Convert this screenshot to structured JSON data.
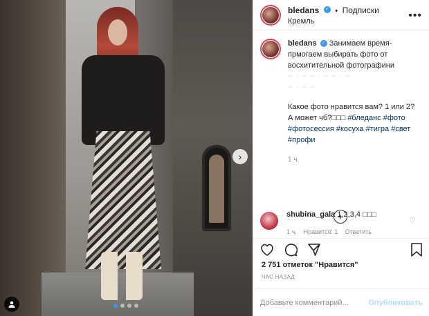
{
  "post": {
    "username": "bledans",
    "separator": "•",
    "follow_label": "Подписки",
    "location": "Кремль",
    "more_glyph": "•••",
    "caption_lines": {
      "line1": "Занимаем время-",
      "line2": "прмогаем выбирать фото от",
      "line3": "восхитительной фотографини",
      "blurred1": "~ · ~ ~ · ~ ~ · ~",
      "blurred2": "~ · ~ ~",
      "question": "Какое фото нравится вам? 1 или 2?",
      "bw": "А может чб?",
      "squares": "□□□"
    },
    "hashtags": [
      "#бледанс",
      "#фото",
      "#фотосессия",
      "#косуха",
      "#тигра",
      "#свет",
      "#профи"
    ],
    "caption_time": "1 ч.",
    "likes": "2 751 отметок \"Нравится\"",
    "posted": "ЧАС НАЗАД"
  },
  "comment": {
    "username": "shubina_gala",
    "text": "1,2,3,4 □□□",
    "time": "1 ч.",
    "likes": "Нравится: 1",
    "reply": "Ответить"
  },
  "add_comment": {
    "placeholder": "Добавьте комментарий...",
    "publish": "Опубликовать"
  },
  "icons": {
    "heart": "heart-icon",
    "comment": "comment-icon",
    "share": "share-icon",
    "save": "bookmark-icon",
    "next": "chevron-right-icon",
    "user_tag": "user-tag-icon",
    "load_more": "plus-circle-icon"
  },
  "carousel": {
    "total": 4,
    "active": 1
  },
  "colors": {
    "accent": "#3897f0",
    "hashtag": "#003569",
    "muted": "#8e8e8e"
  }
}
